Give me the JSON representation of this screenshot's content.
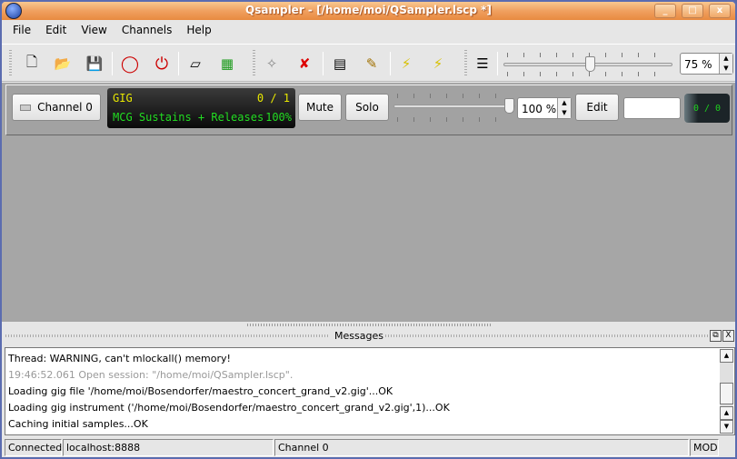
{
  "window": {
    "title": "Qsampler - [/home/moi/QSampler.lscp *]",
    "min": "_",
    "max": "□",
    "close": "x"
  },
  "menu": [
    {
      "label": "File"
    },
    {
      "label": "Edit"
    },
    {
      "label": "View"
    },
    {
      "label": "Channels"
    },
    {
      "label": "Help"
    }
  ],
  "toolbar": {
    "icons": [
      "new-file",
      "open-folder",
      "save",
      "reset-circle",
      "power",
      "midi-device",
      "audio-device",
      "add-channel",
      "remove-channel",
      "setup-channel",
      "edit-channel",
      "reset-channel",
      "reset-all-channels",
      "arrange"
    ],
    "zoom_value": "75 %",
    "zoom_percent": 75
  },
  "channel": {
    "button_label": "Channel 0",
    "engine": "GIG",
    "instrument": "MCG Sustains + Releases",
    "instrument_counter": "0 / 1",
    "fill": "100%",
    "mute_label": "Mute",
    "solo_label": "Solo",
    "volume": "100 %",
    "volume_percent": 100,
    "edit_label": "Edit",
    "edit_field": "",
    "activity": "0 / 0"
  },
  "messages": {
    "title": "Messages",
    "lines": [
      "Thread: WARNING, can't mlockall() memory!",
      "19:46:52.061 Open session: \"/home/moi/QSampler.lscp\".",
      "Loading gig file '/home/moi/Bosendorfer/maestro_concert_grand_v2.gig'...OK",
      "Loading gig instrument ('/home/moi/Bosendorfer/maestro_concert_grand_v2.gig',1)...OK",
      "Caching initial samples...OK"
    ]
  },
  "status": {
    "connection": "Connected",
    "server": "localhost:8888",
    "channel": "Channel 0",
    "modified": "MOD"
  },
  "colors": {
    "display_yellow": "#e8e800",
    "display_green": "#22dd22",
    "title_orange": "#f0a060"
  }
}
